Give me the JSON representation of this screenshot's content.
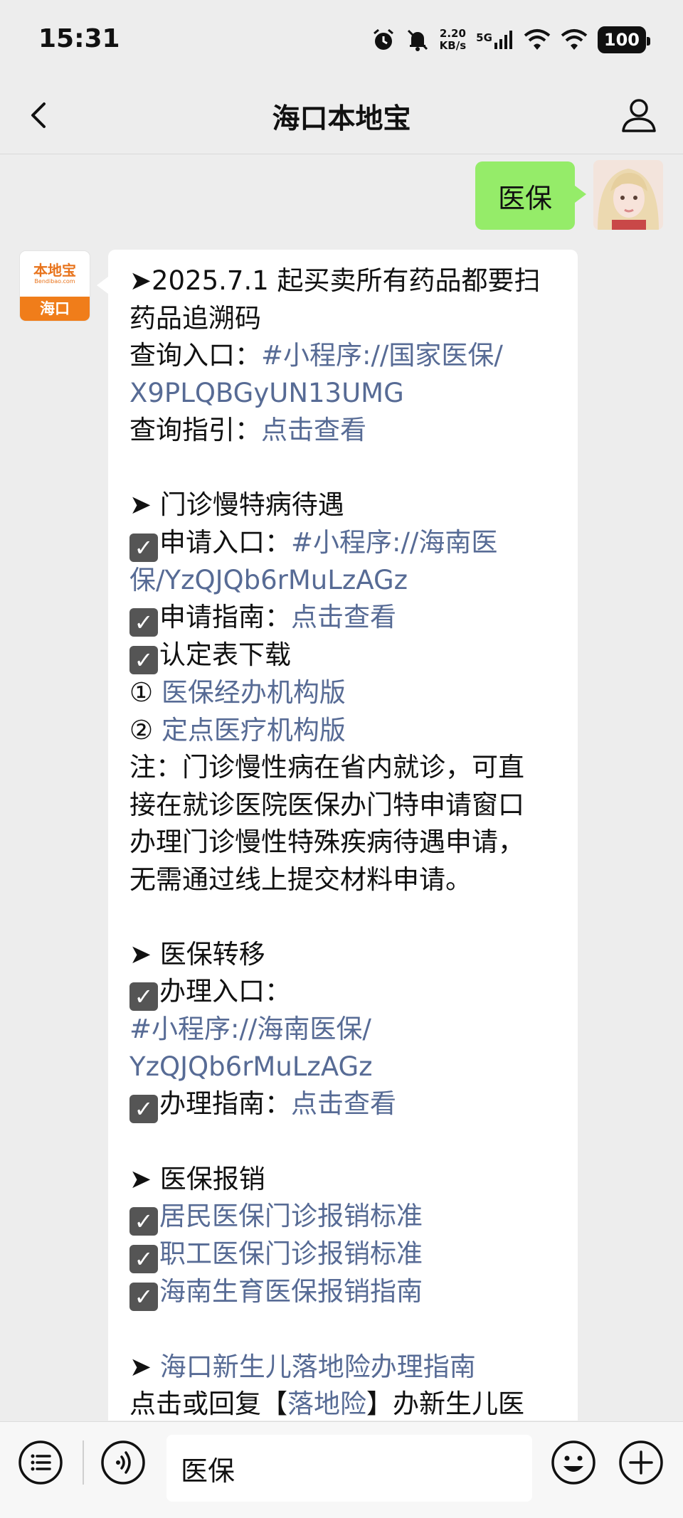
{
  "status_bar": {
    "time": "15:31",
    "net_speed_value": "2.20",
    "net_speed_unit": "KB/s",
    "network_type": "5G",
    "battery": "100",
    "icons": [
      "alarm-icon",
      "mute-bell-icon",
      "signal-icon",
      "wifi-icon",
      "wifi-icon",
      "battery-icon"
    ]
  },
  "nav": {
    "title": "海口本地宝",
    "back_icon": "chevron-left-icon",
    "profile_icon": "user-icon"
  },
  "chat": {
    "sent_message": "医保",
    "bot_avatar": {
      "logo_text": "本地宝",
      "logo_sub": "Bendibao.com",
      "city": "海口"
    },
    "reply_lines": [
      [
        {
          "t": "➤2025.7.1 起买卖所有药品都要扫"
        }
      ],
      [
        {
          "t": "药品追溯码"
        }
      ],
      [
        {
          "t": "查询入口："
        },
        {
          "t": "#小程序://国家医保/",
          "link": true
        }
      ],
      [
        {
          "t": "X9PLQBGyUN13UMG",
          "link": true
        }
      ],
      [
        {
          "t": "查询指引："
        },
        {
          "t": "点击查看",
          "link": true
        }
      ],
      [],
      [
        {
          "t": "➤ 门诊慢特病待遇"
        }
      ],
      [
        {
          "t": "✓",
          "chk": true
        },
        {
          "t": "申请入口："
        },
        {
          "t": "#小程序://海南医",
          "link": true
        }
      ],
      [
        {
          "t": "保/YzQJQb6rMuLzAGz",
          "link": true
        }
      ],
      [
        {
          "t": "✓",
          "chk": true
        },
        {
          "t": "申请指南："
        },
        {
          "t": "点击查看",
          "link": true
        }
      ],
      [
        {
          "t": "✓",
          "chk": true
        },
        {
          "t": "认定表下载"
        }
      ],
      [
        {
          "t": "① "
        },
        {
          "t": "医保经办机构版",
          "link": true
        }
      ],
      [
        {
          "t": "② "
        },
        {
          "t": "定点医疗机构版",
          "link": true
        }
      ],
      [
        {
          "t": "注：门诊慢性病在省内就诊，可直"
        }
      ],
      [
        {
          "t": "接在就诊医院医保办门特申请窗口"
        }
      ],
      [
        {
          "t": "办理门诊慢性特殊疾病待遇申请，"
        }
      ],
      [
        {
          "t": "无需通过线上提交材料申请。"
        }
      ],
      [],
      [
        {
          "t": "➤ 医保转移"
        }
      ],
      [
        {
          "t": "✓",
          "chk": true
        },
        {
          "t": "办理入口："
        }
      ],
      [
        {
          "t": "#小程序://海南医保/",
          "link": true
        }
      ],
      [
        {
          "t": "YzQJQb6rMuLzAGz",
          "link": true
        }
      ],
      [
        {
          "t": "✓",
          "chk": true
        },
        {
          "t": "办理指南："
        },
        {
          "t": "点击查看",
          "link": true
        }
      ],
      [],
      [
        {
          "t": "➤ 医保报销"
        }
      ],
      [
        {
          "t": "✓",
          "chk": true
        },
        {
          "t": "居民医保门诊报销标准",
          "link": true
        }
      ],
      [
        {
          "t": "✓",
          "chk": true
        },
        {
          "t": "职工医保门诊报销标准",
          "link": true
        }
      ],
      [
        {
          "t": "✓",
          "chk": true
        },
        {
          "t": "海南生育医保报销指南",
          "link": true
        }
      ],
      [],
      [
        {
          "t": "➤ "
        },
        {
          "t": "海口新生儿落地险办理指南",
          "link": true
        }
      ],
      [
        {
          "t": "点击或回复【"
        },
        {
          "t": "落地险",
          "link": true
        },
        {
          "t": "】办新生儿医"
        }
      ]
    ]
  },
  "input_bar": {
    "text": "医保",
    "icons": [
      "menu-list-icon",
      "voice-icon",
      "emoji-icon",
      "plus-icon"
    ]
  }
}
